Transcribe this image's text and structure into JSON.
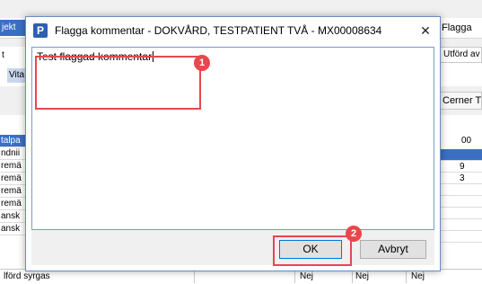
{
  "background": {
    "left_tab": "jekt",
    "right_tab": "Flagga",
    "row_label_t": "t",
    "vital_tab": "Vita",
    "utford_label": "Utförd av",
    "cerner_label": "Cerner T",
    "left_column_cells": [
      "talpa",
      "ndnii",
      "remä",
      "remä",
      "remä",
      "remä",
      "ansk",
      "ansk"
    ],
    "right_column_header": "00",
    "right_column_cells": [
      "",
      "9",
      "3",
      "",
      "",
      "",
      "",
      ""
    ],
    "bottom_row": {
      "label": "lförd syrgas",
      "col1": "Nej",
      "col2": "Nej",
      "col3": "Nej"
    }
  },
  "dialog": {
    "app_icon_letter": "P",
    "title": "Flagga kommentar - DOKVÅRD, TESTPATIENT TVÅ - MX00008634",
    "close_glyph": "✕",
    "comment_text": "Test flaggad kommentar",
    "ok_label": "OK",
    "cancel_label": "Avbryt"
  },
  "annotations": [
    {
      "number": "1",
      "target": "comment-textarea"
    },
    {
      "number": "2",
      "target": "ok-button"
    }
  ],
  "colors": {
    "annotation": "#e8474d",
    "selection": "#3a6fc4",
    "app_icon": "#2f5fb3"
  }
}
